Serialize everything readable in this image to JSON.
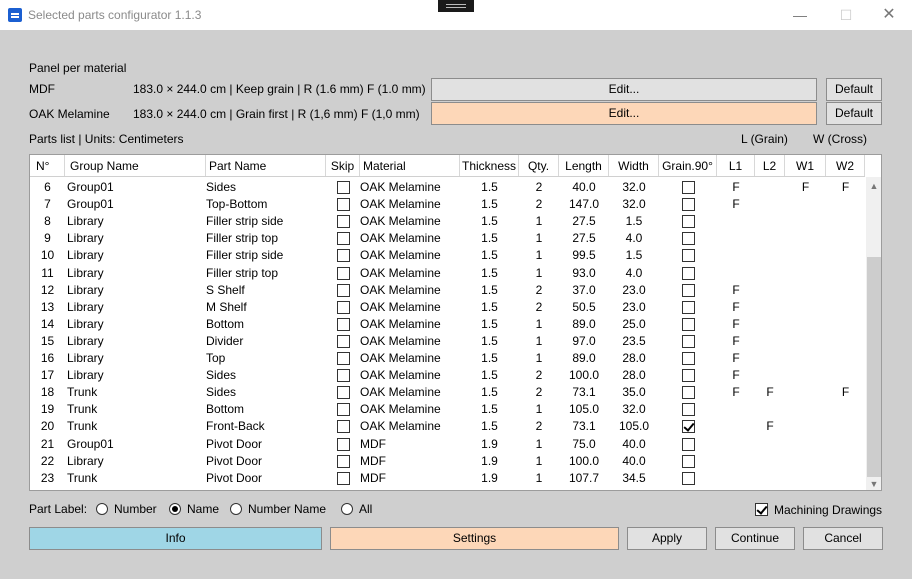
{
  "window": {
    "title": "Selected parts configurator 1.1.3",
    "minimize": "—",
    "maximize": "☐",
    "close": "✕"
  },
  "panel": {
    "heading": "Panel per material",
    "materials": [
      {
        "name": "MDF",
        "spec": "183.0 × 244.0 cm | Keep grain   | R (1.6 mm)  F (1.0 mm)",
        "edit_label": "Edit...",
        "default_label": "Default",
        "edit_color": "#e1e1e1"
      },
      {
        "name": "OAK Melamine",
        "spec": "183.0 × 244.0 cm | Grain first  | R (1,6 mm)  F (1,0 mm)",
        "edit_label": "Edit...",
        "default_label": "Default",
        "edit_color": "#fdd7b8"
      }
    ]
  },
  "parts": {
    "title": "Parts list | Units: Centimeters",
    "legend_grain": "L (Grain)",
    "legend_cross": "W (Cross)",
    "columns": [
      "N°",
      "Group Name",
      "Part Name",
      "Skip",
      "Material",
      "Thickness",
      "Qty.",
      "Length",
      "Width",
      "Grain.90°",
      "L1",
      "L2",
      "W1",
      "W2"
    ],
    "rows": [
      {
        "n": "6",
        "group": "Group01",
        "part": "Sides",
        "skip": false,
        "material": "OAK Melamine",
        "thickness": "1.5",
        "qty": "2",
        "length": "40.0",
        "width": "32.0",
        "grain90": false,
        "l1": "F",
        "l2": "",
        "w1": "F",
        "w2": "F"
      },
      {
        "n": "7",
        "group": "Group01",
        "part": "Top-Bottom",
        "skip": false,
        "material": "OAK Melamine",
        "thickness": "1.5",
        "qty": "2",
        "length": "147.0",
        "width": "32.0",
        "grain90": false,
        "l1": "F",
        "l2": "",
        "w1": "",
        "w2": ""
      },
      {
        "n": "8",
        "group": "Library",
        "part": "Filler strip side",
        "skip": false,
        "material": "OAK Melamine",
        "thickness": "1.5",
        "qty": "1",
        "length": "27.5",
        "width": "1.5",
        "grain90": false,
        "l1": "",
        "l2": "",
        "w1": "",
        "w2": ""
      },
      {
        "n": "9",
        "group": "Library",
        "part": "Filler strip top",
        "skip": false,
        "material": "OAK Melamine",
        "thickness": "1.5",
        "qty": "1",
        "length": "27.5",
        "width": "4.0",
        "grain90": false,
        "l1": "",
        "l2": "",
        "w1": "",
        "w2": ""
      },
      {
        "n": "10",
        "group": "Library",
        "part": "Filler strip side",
        "skip": false,
        "material": "OAK Melamine",
        "thickness": "1.5",
        "qty": "1",
        "length": "99.5",
        "width": "1.5",
        "grain90": false,
        "l1": "",
        "l2": "",
        "w1": "",
        "w2": ""
      },
      {
        "n": "11",
        "group": "Library",
        "part": "Filler strip top",
        "skip": false,
        "material": "OAK Melamine",
        "thickness": "1.5",
        "qty": "1",
        "length": "93.0",
        "width": "4.0",
        "grain90": false,
        "l1": "",
        "l2": "",
        "w1": "",
        "w2": ""
      },
      {
        "n": "12",
        "group": "Library",
        "part": "S Shelf",
        "skip": false,
        "material": "OAK Melamine",
        "thickness": "1.5",
        "qty": "2",
        "length": "37.0",
        "width": "23.0",
        "grain90": false,
        "l1": "F",
        "l2": "",
        "w1": "",
        "w2": ""
      },
      {
        "n": "13",
        "group": "Library",
        "part": "M Shelf",
        "skip": false,
        "material": "OAK Melamine",
        "thickness": "1.5",
        "qty": "2",
        "length": "50.5",
        "width": "23.0",
        "grain90": false,
        "l1": "F",
        "l2": "",
        "w1": "",
        "w2": ""
      },
      {
        "n": "14",
        "group": "Library",
        "part": "Bottom",
        "skip": false,
        "material": "OAK Melamine",
        "thickness": "1.5",
        "qty": "1",
        "length": "89.0",
        "width": "25.0",
        "grain90": false,
        "l1": "F",
        "l2": "",
        "w1": "",
        "w2": ""
      },
      {
        "n": "15",
        "group": "Library",
        "part": "Divider",
        "skip": false,
        "material": "OAK Melamine",
        "thickness": "1.5",
        "qty": "1",
        "length": "97.0",
        "width": "23.5",
        "grain90": false,
        "l1": "F",
        "l2": "",
        "w1": "",
        "w2": ""
      },
      {
        "n": "16",
        "group": "Library",
        "part": "Top",
        "skip": false,
        "material": "OAK Melamine",
        "thickness": "1.5",
        "qty": "1",
        "length": "89.0",
        "width": "28.0",
        "grain90": false,
        "l1": "F",
        "l2": "",
        "w1": "",
        "w2": ""
      },
      {
        "n": "17",
        "group": "Library",
        "part": "Sides",
        "skip": false,
        "material": "OAK Melamine",
        "thickness": "1.5",
        "qty": "2",
        "length": "100.0",
        "width": "28.0",
        "grain90": false,
        "l1": "F",
        "l2": "",
        "w1": "",
        "w2": ""
      },
      {
        "n": "18",
        "group": "Trunk",
        "part": "Sides",
        "skip": false,
        "material": "OAK Melamine",
        "thickness": "1.5",
        "qty": "2",
        "length": "73.1",
        "width": "35.0",
        "grain90": false,
        "l1": "F",
        "l2": "F",
        "w1": "",
        "w2": "F"
      },
      {
        "n": "19",
        "group": "Trunk",
        "part": "Bottom",
        "skip": false,
        "material": "OAK Melamine",
        "thickness": "1.5",
        "qty": "1",
        "length": "105.0",
        "width": "32.0",
        "grain90": false,
        "l1": "",
        "l2": "",
        "w1": "",
        "w2": ""
      },
      {
        "n": "20",
        "group": "Trunk",
        "part": "Front-Back",
        "skip": false,
        "material": "OAK Melamine",
        "thickness": "1.5",
        "qty": "2",
        "length": "73.1",
        "width": "105.0",
        "grain90": true,
        "l1": "",
        "l2": "F",
        "w1": "",
        "w2": ""
      },
      {
        "n": "21",
        "group": "Group01",
        "part": "Pivot Door",
        "skip": false,
        "material": "MDF",
        "thickness": "1.9",
        "qty": "1",
        "length": "75.0",
        "width": "40.0",
        "grain90": false,
        "l1": "",
        "l2": "",
        "w1": "",
        "w2": ""
      },
      {
        "n": "22",
        "group": "Library",
        "part": "Pivot Door",
        "skip": false,
        "material": "MDF",
        "thickness": "1.9",
        "qty": "1",
        "length": "100.0",
        "width": "40.0",
        "grain90": false,
        "l1": "",
        "l2": "",
        "w1": "",
        "w2": ""
      },
      {
        "n": "23",
        "group": "Trunk",
        "part": "Pivot Door",
        "skip": false,
        "material": "MDF",
        "thickness": "1.9",
        "qty": "1",
        "length": "107.7",
        "width": "34.5",
        "grain90": false,
        "l1": "",
        "l2": "",
        "w1": "",
        "w2": ""
      }
    ]
  },
  "part_label": {
    "label": "Part Label:",
    "options": [
      "Number",
      "Name",
      "Number  Name",
      "All"
    ],
    "selected": "Name"
  },
  "machining": {
    "label": "Machining Drawings",
    "checked": true
  },
  "actions": {
    "info": "Info",
    "settings": "Settings",
    "apply": "Apply",
    "continue": "Continue",
    "cancel": "Cancel",
    "info_color": "#9fd6e6",
    "settings_color": "#fdd7b8"
  }
}
